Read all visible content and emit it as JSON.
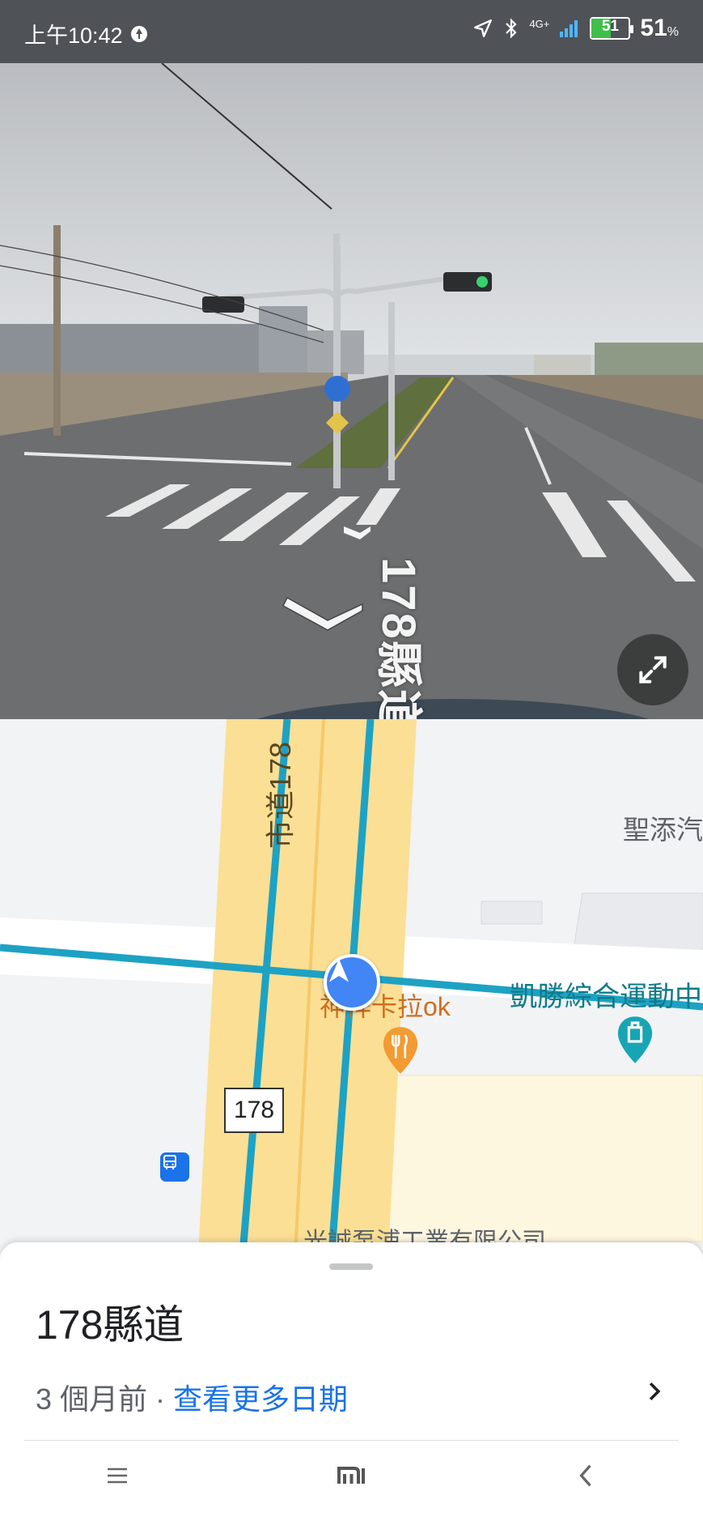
{
  "status_bar": {
    "time": "上午10:42",
    "network": "4G+",
    "battery_level": "51",
    "battery_percent": "51",
    "percent_sign": "%"
  },
  "street_view": {
    "road_marking": "178縣道",
    "expand_icon": "expand-icon"
  },
  "map": {
    "road_vertical_label": "市道178",
    "route_shield": "178",
    "place_top_right": "聖添汽",
    "sports_center": "凱勝綜合運動中",
    "karaoke": "神祥卡拉ok",
    "company": "光誠泵浦工業有限公司",
    "colors": {
      "road_fill": "#fbdf94",
      "route_line": "#1ea2c4",
      "location": "#4285f4"
    }
  },
  "place_sheet": {
    "title": "178縣道",
    "age": "3 個月前 · ",
    "more_dates_link": "查看更多日期"
  },
  "nav_bar": {
    "menu_icon": "menu-icon",
    "home_icon": "mi-logo-icon",
    "back_icon": "back-icon"
  }
}
